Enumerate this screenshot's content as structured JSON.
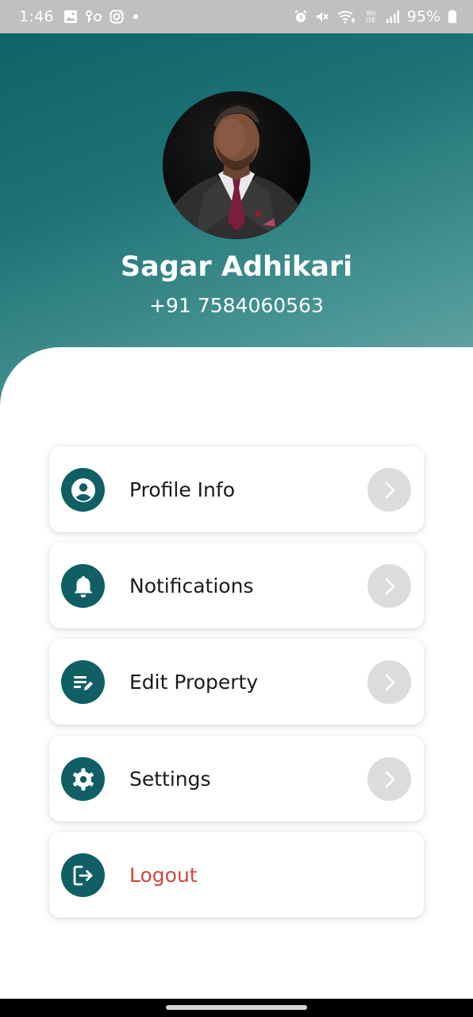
{
  "status_bar": {
    "time": "1:46",
    "battery": "95%",
    "left_icons": [
      "gallery-icon",
      "key-location-icon",
      "instagram-icon",
      "dot-icon"
    ],
    "right_icons": [
      "alarm-icon",
      "mute-icon",
      "wifi-icon",
      "volte-lte-icon",
      "signal-icon",
      "battery-icon"
    ]
  },
  "profile": {
    "name": "Sagar Adhikari",
    "phone": "+91 7584060563"
  },
  "menu": {
    "items": [
      {
        "label": "Profile Info",
        "icon": "account-circle-icon"
      },
      {
        "label": "Notifications",
        "icon": "bell-icon"
      },
      {
        "label": "Edit Property",
        "icon": "edit-list-icon"
      },
      {
        "label": "Settings",
        "icon": "gear-icon"
      },
      {
        "label": "Logout",
        "icon": "logout-icon"
      }
    ]
  },
  "colors": {
    "header_gradient_start": "#0e6467",
    "header_gradient_end": "#6fa8a6",
    "icon_background": "#0f5f64",
    "logout_text": "#c9483c",
    "chevron_background": "#dcdcdc"
  }
}
